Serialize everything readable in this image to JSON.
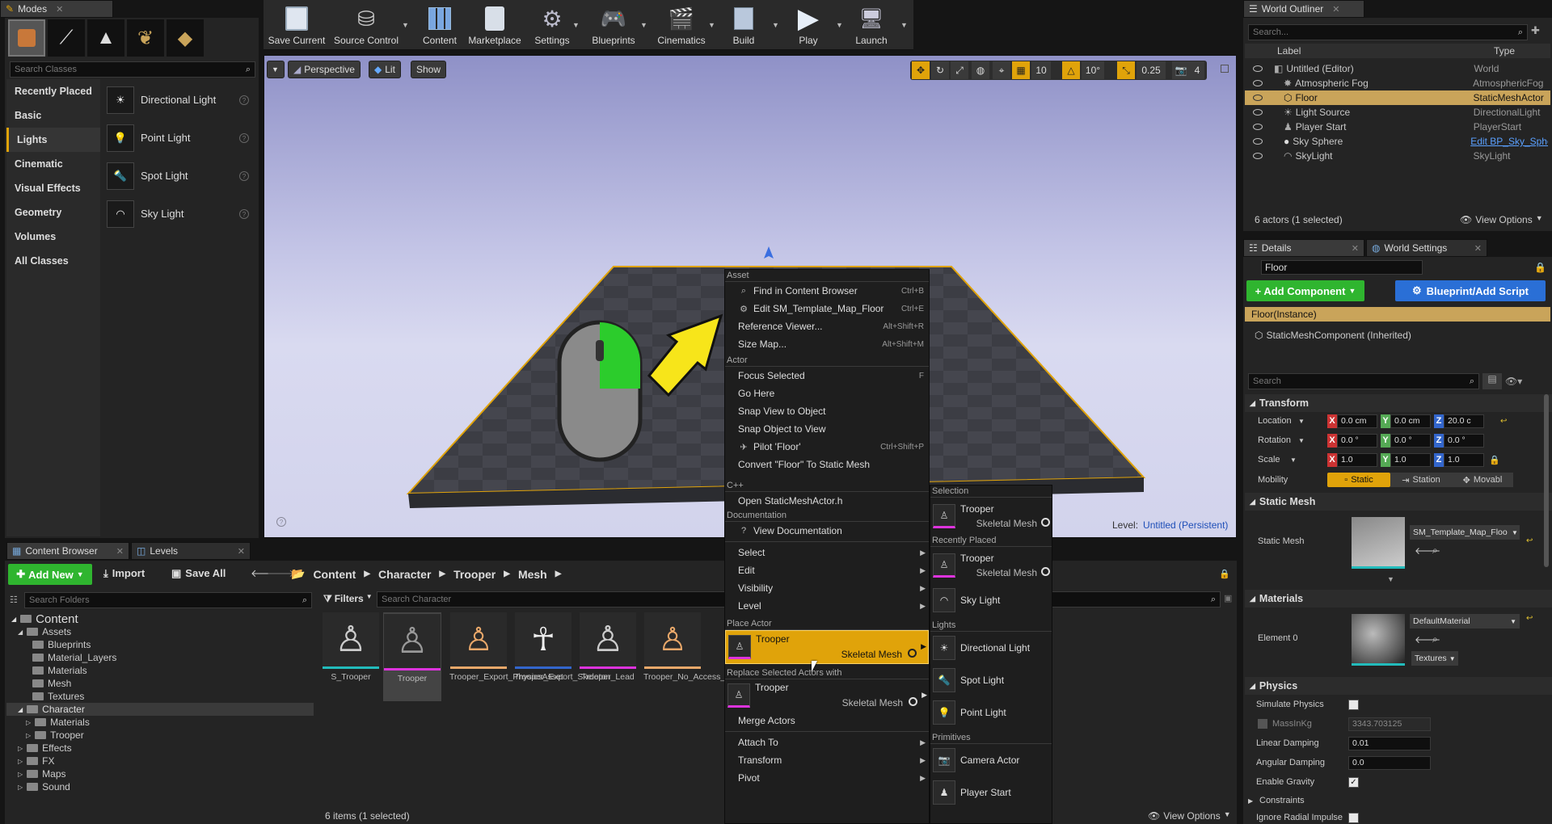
{
  "modes": {
    "tab": "Modes",
    "search_placeholder": "Search Classes",
    "categories": [
      "Recently Placed",
      "Basic",
      "Lights",
      "Cinematic",
      "Visual Effects",
      "Geometry",
      "Volumes",
      "All Classes"
    ],
    "items": [
      "Directional Light",
      "Point Light",
      "Spot Light",
      "Sky Light"
    ]
  },
  "toolbar": {
    "buttons": [
      "Save Current",
      "Source Control",
      "Content",
      "Marketplace",
      "Settings",
      "Blueprints",
      "Cinematics",
      "Build",
      "Play",
      "Launch"
    ]
  },
  "viewport": {
    "perspective": "Perspective",
    "lit": "Lit",
    "show": "Show",
    "snap_grid": "10",
    "snap_rot": "10°",
    "snap_scale": "0.25",
    "cam_speed": "4",
    "level_label": "Level:",
    "level_name": "Untitled (Persistent)"
  },
  "context_menu": {
    "asset_header": "Asset",
    "asset_items": [
      {
        "label": "Find in Content Browser",
        "shortcut": "Ctrl+B"
      },
      {
        "label": "Edit SM_Template_Map_Floor",
        "shortcut": "Ctrl+E"
      },
      {
        "label": "Reference Viewer...",
        "shortcut": "Alt+Shift+R"
      },
      {
        "label": "Size Map...",
        "shortcut": "Alt+Shift+M"
      }
    ],
    "actor_header": "Actor",
    "actor_items": [
      {
        "label": "Focus Selected",
        "shortcut": "F"
      },
      {
        "label": "Go Here",
        "shortcut": ""
      },
      {
        "label": "Snap View to Object",
        "shortcut": ""
      },
      {
        "label": "Snap Object to View",
        "shortcut": ""
      },
      {
        "label": "Pilot 'Floor'",
        "shortcut": "Ctrl+Shift+P"
      },
      {
        "label": "Convert \"Floor\" To Static Mesh",
        "shortcut": ""
      }
    ],
    "cpp_header": "C++",
    "cpp_item": "Open StaticMeshActor.h",
    "doc_header": "Documentation",
    "doc_item": "View Documentation",
    "sub_items": [
      "Select",
      "Edit",
      "Visibility",
      "Level"
    ],
    "place_header": "Place Actor",
    "place_name": "Trooper",
    "place_type": "Skeletal Mesh",
    "replace_header": "Replace Selected Actors with",
    "replace_name": "Trooper",
    "replace_type": "Skeletal Mesh",
    "merge": "Merge Actors",
    "tail_items": [
      "Attach To",
      "Transform",
      "Pivot"
    ]
  },
  "submenu": {
    "selection_header": "Selection",
    "selection": {
      "name": "Trooper",
      "type": "Skeletal Mesh"
    },
    "recent_header": "Recently Placed",
    "recent": [
      {
        "name": "Trooper",
        "type": "Skeletal Mesh"
      },
      {
        "name": "Sky Light",
        "type": ""
      }
    ],
    "lights_header": "Lights",
    "lights": [
      "Directional Light",
      "Spot Light",
      "Point Light"
    ],
    "prims_header": "Primitives",
    "prims": [
      "Camera Actor",
      "Player Start"
    ]
  },
  "outliner": {
    "tab": "World Outliner",
    "search_placeholder": "Search...",
    "col_label": "Label",
    "col_type": "Type",
    "rows": [
      {
        "label": "Untitled (Editor)",
        "type": "World"
      },
      {
        "label": "Atmospheric Fog",
        "type": "AtmosphericFog"
      },
      {
        "label": "Floor",
        "type": "StaticMeshActor"
      },
      {
        "label": "Light Source",
        "type": "DirectionalLight"
      },
      {
        "label": "Player Start",
        "type": "PlayerStart"
      },
      {
        "label": "Sky Sphere",
        "type": "Edit BP_Sky_Sphe"
      },
      {
        "label": "SkyLight",
        "type": "SkyLight"
      }
    ],
    "status": "6 actors (1 selected)",
    "view_options": "View Options"
  },
  "details": {
    "tab": "Details",
    "tab2": "World Settings",
    "name": "Floor",
    "add_component": "+ Add Component",
    "blueprint": "Blueprint/Add Script",
    "instance": "Floor(Instance)",
    "component": "StaticMeshComponent (Inherited)",
    "search_placeholder": "Search",
    "transform": "Transform",
    "location": "Location",
    "rotation": "Rotation",
    "scale": "Scale",
    "mobility": "Mobility",
    "loc": [
      "0.0 cm",
      "0.0 cm",
      "20.0 c"
    ],
    "rot": [
      "0.0 °",
      "0.0 °",
      "0.0 °"
    ],
    "scl": [
      "1.0",
      "1.0",
      "1.0"
    ],
    "mob": [
      "Static",
      "Station",
      "Movabl"
    ],
    "static_mesh_section": "Static Mesh",
    "static_mesh_label": "Static Mesh",
    "static_mesh_value": "SM_Template_Map_Floo",
    "materials_section": "Materials",
    "element0": "Element 0",
    "material_value": "DefaultMaterial",
    "textures": "Textures",
    "physics_section": "Physics",
    "simulate": "Simulate Physics",
    "mass": "MassInKg",
    "mass_value": "3343.703125",
    "linear": "Linear Damping",
    "linear_value": "0.01",
    "angular": "Angular Damping",
    "angular_value": "0.0",
    "gravity": "Enable Gravity",
    "constraints": "Constraints",
    "radial": "Ignore Radial Impulse"
  },
  "content_browser": {
    "tab": "Content Browser",
    "tab2": "Levels",
    "add_new": "Add New",
    "import": "Import",
    "save_all": "Save All",
    "path": [
      "Content",
      "Character",
      "Trooper",
      "Mesh"
    ],
    "search_folders": "Search Folders",
    "filters": "Filters",
    "search_assets": "Search Character",
    "tree": [
      {
        "name": "Content",
        "level": 0
      },
      {
        "name": "Assets",
        "level": 1
      },
      {
        "name": "Blueprints",
        "level": 2
      },
      {
        "name": "Material_Layers",
        "level": 2
      },
      {
        "name": "Materials",
        "level": 2
      },
      {
        "name": "Mesh",
        "level": 2
      },
      {
        "name": "Textures",
        "level": 2
      },
      {
        "name": "Character",
        "level": 1
      },
      {
        "name": "Materials",
        "level": 2
      },
      {
        "name": "Trooper",
        "level": 2
      },
      {
        "name": "Effects",
        "level": 1
      },
      {
        "name": "FX",
        "level": 1
      },
      {
        "name": "Maps",
        "level": 1
      },
      {
        "name": "Sound",
        "level": 1
      }
    ],
    "assets": [
      "S_Trooper",
      "Trooper",
      "Trooper_Export_PhysicsAsset",
      "Trooper_Export_Skeleton",
      "Trooper_Lead",
      "Trooper_No_Access_Export_PhysicsAsset"
    ],
    "status": "6 items (1 selected)",
    "view_options": "View Options"
  },
  "colors": {
    "accent": "#e0a30a",
    "selection": "#c9a45a",
    "green": "#2fb52f",
    "blue": "#2a6fd6"
  }
}
